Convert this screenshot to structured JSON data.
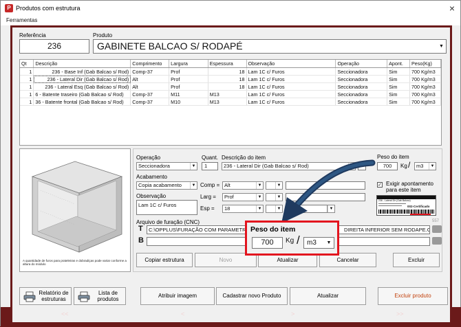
{
  "window": {
    "title": "Produtos com estrutura",
    "close_glyph": "×"
  },
  "menu": {
    "tools": "Ferramentas"
  },
  "header": {
    "ref_label": "Referência",
    "ref_value": "236",
    "product_label": "Produto",
    "product_value": "GABINETE BALCAO S/ RODAPÉ"
  },
  "grid": {
    "columns": [
      "Qt",
      "Descrição",
      "Comprimento",
      "Largura",
      "Espessura",
      "Observação",
      "Operação",
      "Apont.",
      "Peso(Kg)"
    ],
    "rows": [
      [
        "1",
        "236 - Base Inf (Gab Balcao s/ Rod)",
        "Comp-37",
        "Prof",
        "18",
        "Lam 1C c/ Furos",
        "Seccionadora",
        "Sim",
        "700 Kg/m3"
      ],
      [
        "1",
        "236 - Lateral Dir (Gab Balcao s/ Rod)",
        "Alt",
        "Prof",
        "18",
        "Lam 1C c/ Furos",
        "Seccionadora",
        "Sim",
        "700 Kg/m3"
      ],
      [
        "1",
        "236 - Lateral Esq (Gab Balcao s/ Rod)",
        "Alt",
        "Prof",
        "18",
        "Lam 1C c/ Furos",
        "Seccionadora",
        "Sim",
        "700 Kg/m3"
      ],
      [
        "1",
        "6 - Batente traseiro (Gab Balcao s/ Rod)",
        "Comp-37",
        "M11",
        "M13",
        "Lam 1C c/ Furos",
        "Seccionadora",
        "Sim",
        "700 Kg/m3"
      ],
      [
        "1",
        "36 - Batente frontal (Gab Balcao s/ Rod)",
        "Comp-37",
        "M10",
        "M13",
        "Lam 1C c/ Furos",
        "Seccionadora",
        "Sim",
        "700 Kg/m3"
      ]
    ]
  },
  "image_caption": "A quantidade de furos para prateleiras e dobradiças pode variar conforme a altura do módulo",
  "editor": {
    "operation_label": "Operação",
    "operation_value": "Seccionadora",
    "quant_label": "Quant.",
    "quant_value": "1",
    "desc_label": "Descrição do item",
    "desc_value": "236 - Lateral Dir (Gab Balcao s/ Rod)",
    "weight_label": "Peso do item",
    "weight_value": "700",
    "weight_kg": "Kg",
    "weight_unit": "m3",
    "finish_label": "Acabamento",
    "finish_value": "Copia acabamento",
    "comp_label": "Comp =",
    "comp_value": "Alt",
    "larg_label": "Larg =",
    "larg_value": "Prof",
    "esp_label": "Esp =",
    "esp_value": "18",
    "obs_label": "Observação",
    "obs_value": "Lam 1C c/ Furos",
    "require_label": "Exigir apontamento para este item",
    "cnc_label": "Arquivo de furação (CNC)",
    "cnc_count": "557",
    "cnc_path_left": "C:\\OPPLUS\\FURAÇÃO COM PARAMETRO",
    "cnc_path_right": "DIREITA INFERIOR SEM RODAPE.GBS",
    "barcode_text": "002-Certificado",
    "thumb_title": "236 - Lateral Dir (Gab Balcao)"
  },
  "callout": {
    "title": "Peso do item",
    "value": "700",
    "kg": "Kg",
    "unit": "m3"
  },
  "actions": {
    "copy": "Copiar estrutura",
    "new": "Novo",
    "update": "Atualizar",
    "cancel": "Cancelar",
    "delete": "Excluir"
  },
  "footer": {
    "report": "Relatório de estruturas",
    "list": "Lista de produtos",
    "attach_image": "Atribuir imagem",
    "register_new": "Cadastrar novo Produto",
    "update": "Atualizar",
    "delete_product": "Excluir produto"
  },
  "nav": {
    "first": "<<",
    "prev": "<",
    "next": ">",
    "last": ">>"
  },
  "colors": {
    "frame": "#6b1a1a",
    "callout_border": "#e3141e",
    "arrow": "#1f3a5f"
  }
}
